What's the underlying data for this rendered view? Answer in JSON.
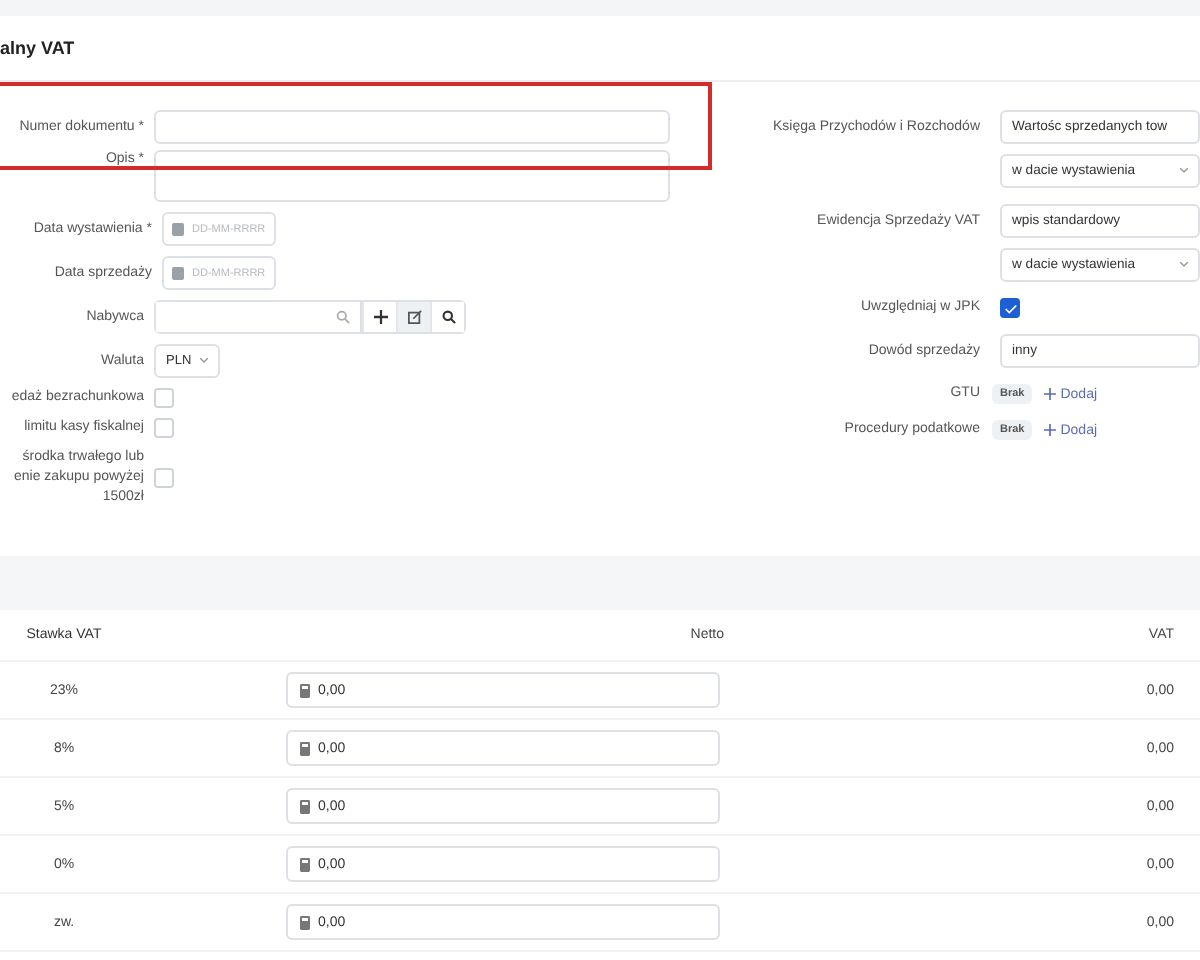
{
  "title": "alny VAT",
  "left_form": {
    "highlight": true,
    "fields": [
      {
        "kind": "text",
        "label": "Numer dokumentu *"
      },
      {
        "kind": "textarea",
        "label": "Opis *"
      },
      {
        "kind": "date",
        "label": "Data wystawienia *",
        "placeholder": "DD-MM-RRRR"
      },
      {
        "kind": "date",
        "label": "Data sprzedaży",
        "placeholder": "DD-MM-RRRR"
      },
      {
        "kind": "search",
        "label": "Nabywca"
      },
      {
        "kind": "select",
        "label": "Waluta",
        "value": "PLN"
      },
      {
        "kind": "checkbox",
        "label": "edaż bezrachunkowa",
        "checked": false
      },
      {
        "kind": "checkbox",
        "label": "limitu kasy fiskalnej",
        "checked": false
      },
      {
        "kind": "checkbox",
        "label": "środka trwałego lub\nenie zakupu powyżej\n1500zł",
        "checked": false
      }
    ]
  },
  "right_form": {
    "fields": [
      {
        "kind": "selects",
        "label": "Księga Przychodów i Rozchodów",
        "values": [
          "Wartośc sprzedanych tow",
          "w dacie wystawienia"
        ]
      },
      {
        "kind": "selects",
        "label": "Ewidencja Sprzedaży VAT",
        "values": [
          "wpis standardowy",
          "w dacie wystawienia"
        ]
      },
      {
        "kind": "checkbox",
        "label": "Uwzględniaj w JPK",
        "checked": true
      },
      {
        "kind": "text",
        "label": "Dowód sprzedaży",
        "value": "inny"
      },
      {
        "kind": "tags",
        "label": "GTU",
        "badge": "Brak",
        "link": "Dodaj"
      },
      {
        "kind": "tags",
        "label": "Procedury podatkowe",
        "badge": "Brak",
        "link": "Dodaj"
      }
    ]
  },
  "table": {
    "columns": [
      "Stawka VAT",
      "Netto",
      "VAT"
    ],
    "rows": [
      {
        "rate": "23%",
        "netto": "0,00",
        "vat": "0,00"
      },
      {
        "rate": "8%",
        "netto": "0,00",
        "vat": "0,00"
      },
      {
        "rate": "5%",
        "netto": "0,00",
        "vat": "0,00"
      },
      {
        "rate": "0%",
        "netto": "0,00",
        "vat": "0,00"
      },
      {
        "rate": "zw.",
        "netto": "0,00",
        "vat": "0,00"
      }
    ]
  }
}
